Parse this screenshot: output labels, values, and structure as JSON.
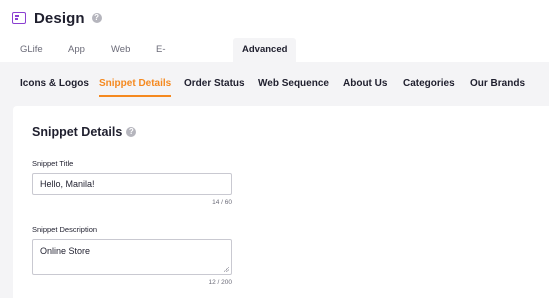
{
  "header": {
    "title": "Design",
    "app_icon": "design-template-icon",
    "help_icon": "help-icon"
  },
  "top_tabs": [
    {
      "label": "GLife"
    },
    {
      "label": "App"
    },
    {
      "label": "Web"
    },
    {
      "label": "E-Store Banner"
    },
    {
      "label": "Advanced Settings",
      "active": true
    }
  ],
  "sub_tabs": [
    {
      "label": "Icons & Logos"
    },
    {
      "label": "Snippet Details",
      "active": true
    },
    {
      "label": "Order Status"
    },
    {
      "label": "Web Sequence"
    },
    {
      "label": "About Us"
    },
    {
      "label": "Categories"
    },
    {
      "label": "Our Brands"
    }
  ],
  "card": {
    "title": "Snippet Details",
    "snippet_title": {
      "label": "Snippet Title",
      "value": "Hello, Manila!",
      "counter": "14 / 60"
    },
    "snippet_description": {
      "label": "Snippet Description",
      "value": "Online Store",
      "counter": "12 / 200"
    }
  },
  "colors": {
    "accent": "#f5891f",
    "brand_icon": "#8a3fd1",
    "panel_bg": "#f4f4f6"
  }
}
